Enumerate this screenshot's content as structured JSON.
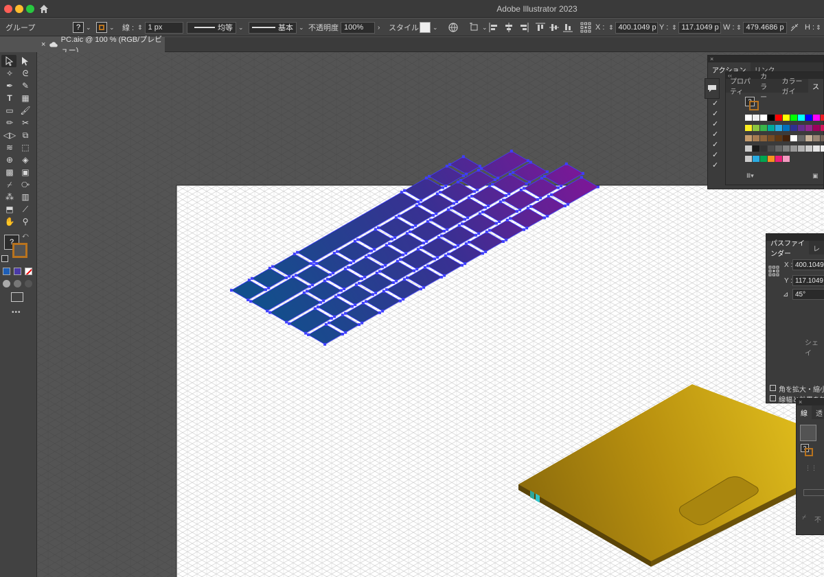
{
  "window": {
    "title": "Adobe Illustrator 2023"
  },
  "control_bar": {
    "selection_label": "グループ",
    "stroke_label": "線 :",
    "stroke_weight": "1 px",
    "profile_uniform": "均等",
    "brush_basic": "基本",
    "opacity_label": "不透明度 :",
    "opacity_value": "100%",
    "style_label": "スタイル :",
    "x_label": "X :",
    "x_value": "400.1049 p",
    "y_label": "Y :",
    "y_value": "117.1049 p",
    "w_label": "W :",
    "w_value": "479.4686 p",
    "h_label": "H :",
    "fill_glyph": "?"
  },
  "document_tab": {
    "name": "PC.aic @ 100 % (RGB/プレビュー)",
    "close": "×"
  },
  "tools_more": "•••",
  "tools_fill_glyph": "?",
  "actions_panel": {
    "tabs": [
      "アクション",
      "リンク"
    ],
    "close": "×",
    "collapse": "››"
  },
  "swatches_panel": {
    "tabs": [
      "プロパティ",
      "カラー",
      "カラーガイ",
      "ス"
    ],
    "collapse": "‹‹",
    "fill_glyph": "?"
  },
  "pathfinder_panel": {
    "tabs": [
      "パスファインダー",
      "レ"
    ],
    "x_label": "X :",
    "x_value": "400.1049",
    "y_label": "Y :",
    "y_value": "117.1049",
    "angle_value": "45°",
    "shape_label": "シェイ",
    "scale_corners": "角を拡大・縮小",
    "scale_strokes": "線幅と効果を拡"
  },
  "stroke_panel": {
    "tabs": [
      "線",
      "透"
    ],
    "close": "×",
    "fill_glyph": "?",
    "bottom_text": "不"
  },
  "colors": {
    "accent": "#1a6be0",
    "key_start": "#16508f",
    "key_end": "#9a0a9a",
    "anchor": "#3e3eff",
    "laptop": "#c9a317"
  }
}
